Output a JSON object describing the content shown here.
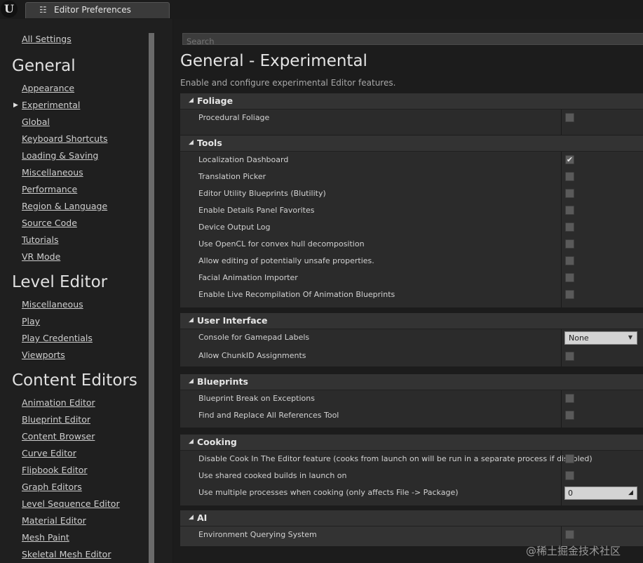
{
  "window": {
    "logo": "U",
    "tab_label": "Editor Preferences",
    "tab_icon": "settings-sliders-icon"
  },
  "sidebar": {
    "all_settings": "All Settings",
    "sections": [
      {
        "title": "General",
        "items": [
          "Appearance",
          "Experimental",
          "Global",
          "Keyboard Shortcuts",
          "Loading & Saving",
          "Miscellaneous",
          "Performance",
          "Region & Language",
          "Source Code",
          "Tutorials",
          "VR Mode"
        ]
      },
      {
        "title": "Level Editor",
        "items": [
          "Miscellaneous",
          "Play",
          "Play Credentials",
          "Viewports"
        ]
      },
      {
        "title": "Content Editors",
        "items": [
          "Animation Editor",
          "Blueprint Editor",
          "Content Browser",
          "Curve Editor",
          "Flipbook Editor",
          "Graph Editors",
          "Level Sequence Editor",
          "Material Editor",
          "Mesh Paint",
          "Skeletal Mesh Editor"
        ]
      }
    ],
    "selected": "Experimental"
  },
  "search": {
    "placeholder": "Search"
  },
  "page": {
    "title": "General - Experimental",
    "description": "Enable and configure experimental Editor features."
  },
  "categories": {
    "foliage": {
      "title": "Foliage",
      "rows": [
        "Procedural Foliage"
      ]
    },
    "tools": {
      "title": "Tools",
      "rows": [
        "Localization Dashboard",
        "Translation Picker",
        "Editor Utility Blueprints (Blutility)",
        "Enable Details Panel Favorites",
        "Device Output Log",
        "Use OpenCL for convex hull decomposition",
        "Allow editing of potentially unsafe properties.",
        "Facial Animation Importer",
        "Enable Live Recompilation Of Animation Blueprints"
      ]
    },
    "ui": {
      "title": "User Interface",
      "rows": [
        "Console for Gamepad Labels",
        "Allow ChunkID Assignments"
      ],
      "gamepad_value": "None"
    },
    "blueprints": {
      "title": "Blueprints",
      "rows": [
        "Blueprint Break on Exceptions",
        "Find and Replace All References Tool"
      ]
    },
    "cooking": {
      "title": "Cooking",
      "rows": [
        "Disable Cook In The Editor feature (cooks from launch on will be run in a separate process if disabled)",
        "Use shared cooked builds in launch on",
        "Use multiple processes when cooking (only affects File -> Package)"
      ],
      "processes_value": "0"
    },
    "ai": {
      "title": "AI",
      "rows": [
        "Environment Querying System"
      ]
    }
  },
  "checkbox": {
    "checked_glyph": "✔"
  },
  "watermark": "@稀土掘金技术社区"
}
